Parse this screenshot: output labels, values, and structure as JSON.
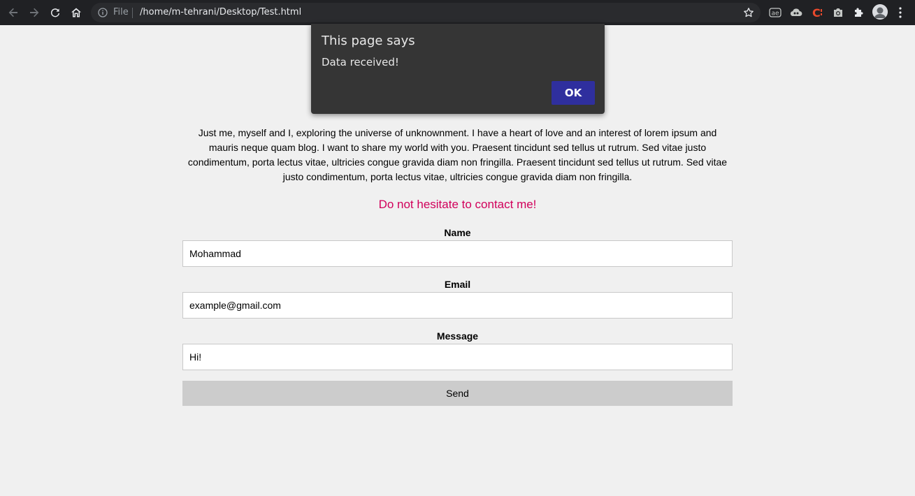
{
  "browser": {
    "omnibox": {
      "scheme_label": "File",
      "url": "/home/m-tehrani/Desktop/Test.html"
    },
    "toolbar_icons": [
      "back-icon",
      "forward-icon",
      "reload-icon",
      "home-icon",
      "info-icon",
      "bookmark-star-icon",
      "translate-extension-icon",
      "cloud-extension-icon",
      "c-extension-icon",
      "camera-extension-icon",
      "extensions-puzzle-icon",
      "profile-avatar",
      "menu-kebab-icon"
    ]
  },
  "page": {
    "bio": "Just me, myself and I, exploring the universe of unknownment. I have a heart of love and an interest of lorem ipsum and mauris neque quam blog. I want to share my world with you. Praesent tincidunt sed tellus ut rutrum. Sed vitae justo condimentum, porta lectus vitae, ultricies congue gravida diam non fringilla. Praesent tincidunt sed tellus ut rutrum. Sed vitae justo condimentum, porta lectus vitae, ultricies congue gravida diam non fringilla.",
    "cta": "Do not hesitate to contact me!",
    "cta_color": "#d1005b",
    "form": {
      "name_label": "Name",
      "name_value": "Mohammad",
      "email_label": "Email",
      "email_value": "example@gmail.com",
      "message_label": "Message",
      "message_value": "Hi!",
      "send_label": "Send"
    }
  },
  "dialog": {
    "title": "This page says",
    "message": "Data received!",
    "ok_label": "OK",
    "ok_color": "#2f2f9e"
  }
}
